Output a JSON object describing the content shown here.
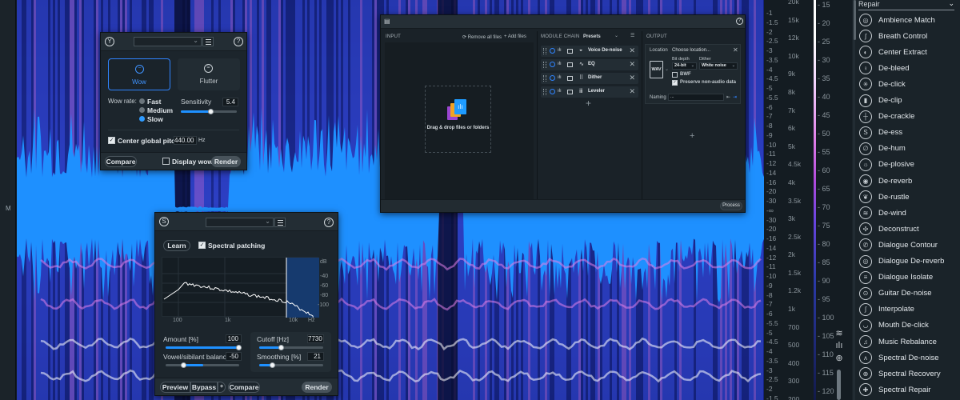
{
  "editor": {
    "channel_label": "M",
    "colors": {
      "waveform": "#1e90ff",
      "spectro_bg": "#0d1a6a",
      "spectro_hot": "#e07fe8",
      "accent": "#2f84ff"
    }
  },
  "scales": {
    "db_ticks": [
      "-1",
      "-1.5",
      "-2",
      "-2.5",
      "-3",
      "-3.5",
      "-4",
      "-4.5",
      "-5",
      "-5.5",
      "-6",
      "-7",
      "-8",
      "-9",
      "-10",
      "-11",
      "-12",
      "-14",
      "-16",
      "-20",
      "-30",
      "-∞",
      "-30",
      "-20",
      "-16",
      "-14",
      "-12",
      "-11",
      "-10",
      "-9",
      "-8",
      "-7",
      "-6",
      "-5.5",
      "-5",
      "-4.5",
      "-4",
      "-3.5",
      "-3",
      "-2.5",
      "-2",
      "-1.5"
    ],
    "freq_ticks": [
      "20k",
      "15k",
      "12k",
      "10k",
      "9k",
      "8k",
      "7k",
      "6k",
      "5k",
      "4.5k",
      "4k",
      "3.5k",
      "3k",
      "2.5k",
      "2k",
      "1.5k",
      "1.2k",
      "1k",
      "700",
      "500",
      "400",
      "300",
      "200"
    ],
    "amp_ticks": [
      "15",
      "20",
      "25",
      "30",
      "35",
      "40",
      "45",
      "50",
      "55",
      "60",
      "65",
      "70",
      "75",
      "80",
      "85",
      "90",
      "95",
      "100",
      "105",
      "110",
      "115",
      "120"
    ],
    "view_tools": [
      {
        "icon": "waveform-spectrogram-icon"
      },
      {
        "icon": "vertical-zoom-icon"
      },
      {
        "icon": "magnifier-icon"
      }
    ]
  },
  "module_list": {
    "category": "Repair",
    "items": [
      {
        "label": "Ambience Match",
        "icon": "ambience-match-icon",
        "glyph": "◎"
      },
      {
        "label": "Breath Control",
        "icon": "breath-control-icon",
        "glyph": "ʃ"
      },
      {
        "label": "Center Extract",
        "icon": "center-extract-icon",
        "glyph": "◐"
      },
      {
        "label": "De-bleed",
        "icon": "microphone-icon",
        "glyph": "♀"
      },
      {
        "label": "De-click",
        "icon": "de-click-icon",
        "glyph": "✳"
      },
      {
        "label": "De-clip",
        "icon": "de-clip-icon",
        "glyph": "▮"
      },
      {
        "label": "De-crackle",
        "icon": "de-crackle-icon",
        "glyph": "┼"
      },
      {
        "label": "De-ess",
        "icon": "de-ess-icon",
        "glyph": "S"
      },
      {
        "label": "De-hum",
        "icon": "de-hum-icon",
        "glyph": "∅"
      },
      {
        "label": "De-plosive",
        "icon": "de-plosive-icon",
        "glyph": "☼"
      },
      {
        "label": "De-reverb",
        "icon": "de-reverb-icon",
        "glyph": "◉"
      },
      {
        "label": "De-rustle",
        "icon": "de-rustle-icon",
        "glyph": "❦"
      },
      {
        "label": "De-wind",
        "icon": "de-wind-icon",
        "glyph": "≋"
      },
      {
        "label": "Deconstruct",
        "icon": "deconstruct-icon",
        "glyph": "✣"
      },
      {
        "label": "Dialogue Contour",
        "icon": "dialogue-contour-icon",
        "glyph": "✆"
      },
      {
        "label": "Dialogue De-reverb",
        "icon": "dialogue-de-reverb-icon",
        "glyph": "◎"
      },
      {
        "label": "Dialogue Isolate",
        "icon": "dialogue-isolate-icon",
        "glyph": "≡"
      },
      {
        "label": "Guitar De-noise",
        "icon": "guitar-de-noise-icon",
        "glyph": "⊙"
      },
      {
        "label": "Interpolate",
        "icon": "interpolate-icon",
        "glyph": "∫"
      },
      {
        "label": "Mouth De-click",
        "icon": "mouth-de-click-icon",
        "glyph": "◡"
      },
      {
        "label": "Music Rebalance",
        "icon": "music-rebalance-icon",
        "glyph": "♫"
      },
      {
        "label": "Spectral De-noise",
        "icon": "spectral-de-noise-icon",
        "glyph": "ʌ"
      },
      {
        "label": "Spectral Recovery",
        "icon": "spectral-recovery-icon",
        "glyph": "⊕"
      },
      {
        "label": "Spectral Repair",
        "icon": "spectral-repair-icon",
        "glyph": "✚"
      }
    ]
  },
  "wow_panel": {
    "preset_value": "",
    "modes": [
      {
        "label": "Wow",
        "active": true
      },
      {
        "label": "Flutter",
        "active": false
      }
    ],
    "rate_label": "Wow rate:",
    "rates": [
      {
        "label": "Fast",
        "selected": false
      },
      {
        "label": "Medium",
        "selected": false
      },
      {
        "label": "Slow",
        "selected": true
      }
    ],
    "sensitivity_label": "Sensitivity",
    "sensitivity_value": "5.4",
    "sensitivity_fraction": 0.54,
    "center_pitch_label": "Center global pitch to",
    "center_pitch_checked": true,
    "center_pitch_value": "440.00",
    "center_pitch_unit": "Hz",
    "compare_label": "Compare",
    "display_wow_label": "Display wow",
    "display_wow_checked": false,
    "render_label": "Render"
  },
  "deess_panel": {
    "preset_value": "",
    "learn_label": "Learn",
    "spectral_patching_label": "Spectral patching",
    "spectral_patching_checked": true,
    "graph": {
      "x_ticks": [
        "100",
        "1k",
        "10k",
        "Hz"
      ],
      "y_ticks": [
        "dB",
        "-40",
        "-60",
        "-80",
        "-100"
      ]
    },
    "controls": [
      {
        "label": "Amount [%]",
        "value": "100",
        "fraction": 1.0
      },
      {
        "label": "Vowel/sibilant balance",
        "value": "-50",
        "fraction": 0.25
      },
      {
        "label": "Cutoff [Hz]",
        "value": "7730",
        "fraction": 0.35
      },
      {
        "label": "Smoothing [%]",
        "value": "21",
        "fraction": 0.21
      }
    ],
    "preview_label": "Preview",
    "bypass_label": "Bypass",
    "bypass_extra": "+",
    "compare_label": "Compare",
    "render_label": "Render"
  },
  "batch_panel": {
    "input_label": "INPUT",
    "remove_all_label": "Remove all files",
    "add_files_label": "Add files",
    "drop_label": "Drag & drop files or folders",
    "module_chain_label": "MODULE CHAIN",
    "presets_label": "Presets",
    "chain": [
      {
        "name": "Voice De-noise",
        "icon": "voice-de-noise-icon",
        "glyph": "◒"
      },
      {
        "name": "EQ",
        "icon": "eq-icon",
        "glyph": "∿"
      },
      {
        "name": "Dither",
        "icon": "dither-icon",
        "glyph": "⠿"
      },
      {
        "name": "Leveler",
        "icon": "leveler-icon",
        "glyph": "ⅲ"
      }
    ],
    "output_label": "OUTPUT",
    "location_label": "Location",
    "location_value": "Choose location...",
    "format_badge": "WAV",
    "bit_depth_label": "Bit depth",
    "bit_depth_value": "24-bit",
    "dither_label": "Dither",
    "dither_value": "White noise",
    "bwf_label": "BWF",
    "bwf_checked": false,
    "preserve_label": "Preserve non-audio data",
    "preserve_checked": true,
    "naming_label": "Naming",
    "naming_value": "...",
    "process_label": "Process"
  }
}
